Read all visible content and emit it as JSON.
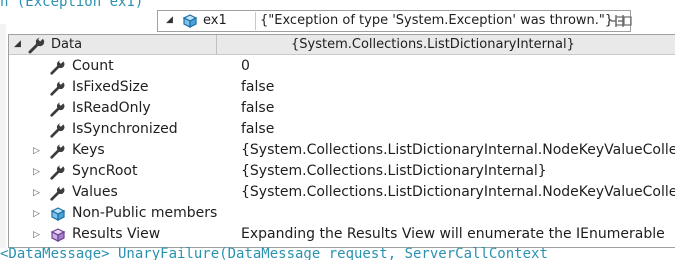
{
  "code": {
    "top_line": "n (Exception ex1)",
    "bottom_line": "<DataMessage> UnaryFailure(DataMessage request, ServerCallContext"
  },
  "datatip": {
    "expander": "◢",
    "name": "ex1",
    "value": "{\"Exception of type 'System.Exception' was thrown.\"}",
    "icon": "object-cube-icon",
    "pin_icon": "pin-icon"
  },
  "panel": {
    "header_name": "Data",
    "header_value": "{System.Collections.ListDictionaryInternal}",
    "rows": [
      {
        "name": "Count",
        "value": "0",
        "icon": "wrench-icon",
        "expandable": false
      },
      {
        "name": "IsFixedSize",
        "value": "false",
        "icon": "wrench-icon",
        "expandable": false
      },
      {
        "name": "IsReadOnly",
        "value": "false",
        "icon": "wrench-icon",
        "expandable": false
      },
      {
        "name": "IsSynchronized",
        "value": "false",
        "icon": "wrench-icon",
        "expandable": false
      },
      {
        "name": "Keys",
        "value": "{System.Collections.ListDictionaryInternal.NodeKeyValueCollectio",
        "icon": "wrench-icon",
        "expandable": true
      },
      {
        "name": "SyncRoot",
        "value": "{System.Collections.ListDictionaryInternal}",
        "icon": "wrench-icon",
        "expandable": true
      },
      {
        "name": "Values",
        "value": "{System.Collections.ListDictionaryInternal.NodeKeyValueCollectio",
        "icon": "wrench-icon",
        "expandable": true
      },
      {
        "name": "Non-Public members",
        "value": "",
        "icon": "object-cube-icon",
        "expandable": true
      },
      {
        "name": "Results View",
        "value": "Expanding the Results View will enumerate the IEnumerable",
        "icon": "results-cube-icon",
        "expandable": true
      }
    ]
  },
  "colors": {
    "code_type": "#2b91af",
    "header_bg": "#e9e9e9",
    "border": "#a0a0a0"
  }
}
